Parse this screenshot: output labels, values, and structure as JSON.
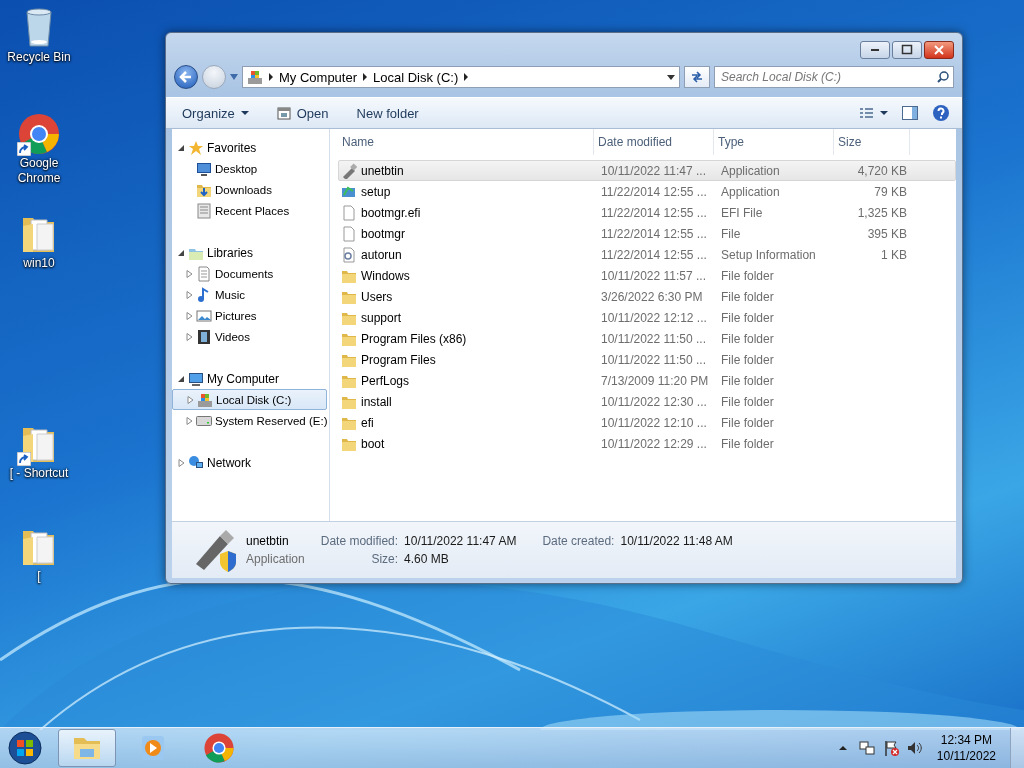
{
  "desktop": {
    "icons": [
      {
        "label": "Recycle Bin",
        "kind": "recycle",
        "shortcut": false
      },
      {
        "label": "Google Chrome",
        "kind": "chrome",
        "shortcut": true
      },
      {
        "label": "win10",
        "kind": "folder",
        "shortcut": false
      },
      {
        "label": "[ - Shortcut",
        "kind": "folder",
        "shortcut": true
      },
      {
        "label": "[",
        "kind": "folder",
        "shortcut": false
      }
    ]
  },
  "window": {
    "controls": [
      {
        "kind": "minimize",
        "hovered": false
      },
      {
        "kind": "maximize",
        "hovered": false
      },
      {
        "kind": "close",
        "hovered": true
      }
    ],
    "address": {
      "crumbs": [
        "My Computer",
        "Local Disk (C:)"
      ]
    },
    "search": {
      "placeholder": "Search Local Disk (C:)"
    },
    "toolbar": [
      {
        "label": "Organize",
        "kind": "menu"
      },
      {
        "label": "Open",
        "kind": "open"
      },
      {
        "label": "New folder",
        "kind": "plain"
      }
    ],
    "navigation": [
      {
        "label": "Favorites",
        "kind": "star",
        "expanded": true,
        "selected": false,
        "children": [
          {
            "label": "Desktop",
            "kind": "desktop",
            "selected": false
          },
          {
            "label": "Downloads",
            "kind": "downloads",
            "selected": false
          },
          {
            "label": "Recent Places",
            "kind": "recent",
            "selected": false
          }
        ]
      },
      {
        "label": "Libraries",
        "kind": "library",
        "expanded": true,
        "selected": false,
        "children": [
          {
            "label": "Documents",
            "kind": "documents",
            "expanded": false,
            "selected": false
          },
          {
            "label": "Music",
            "kind": "music",
            "expanded": false,
            "selected": false
          },
          {
            "label": "Pictures",
            "kind": "pictures",
            "expanded": false,
            "selected": false
          },
          {
            "label": "Videos",
            "kind": "videos",
            "expanded": false,
            "selected": false
          }
        ]
      },
      {
        "label": "My Computer",
        "kind": "computer",
        "expanded": true,
        "selected": false,
        "children": [
          {
            "label": "Local Disk (C:)",
            "kind": "disk",
            "expanded": false,
            "selected": true
          },
          {
            "label": "System Reserved (E:)",
            "kind": "drive",
            "expanded": false,
            "selected": false
          }
        ]
      },
      {
        "label": "Network",
        "kind": "network",
        "expanded": false,
        "selected": false
      }
    ],
    "table": {
      "columns": [
        "Name",
        "Date modified",
        "Type",
        "Size"
      ],
      "rows": [
        {
          "name": "unetbtin",
          "kind": "usb",
          "date": "10/11/2022 11:47 ...",
          "type": "Application",
          "size": "4,720 KB",
          "selected": true
        },
        {
          "name": "setup",
          "kind": "setup",
          "date": "11/22/2014 12:55 ...",
          "type": "Application",
          "size": "79 KB",
          "selected": false
        },
        {
          "name": "bootmgr.efi",
          "kind": "file",
          "date": "11/22/2014 12:55 ...",
          "type": "EFI File",
          "size": "1,325 KB",
          "selected": false
        },
        {
          "name": "bootmgr",
          "kind": "file",
          "date": "11/22/2014 12:55 ...",
          "type": "File",
          "size": "395 KB",
          "selected": false
        },
        {
          "name": "autorun",
          "kind": "settings",
          "date": "11/22/2014 12:55 ...",
          "type": "Setup Information",
          "size": "1 KB",
          "selected": false
        },
        {
          "name": "Windows",
          "kind": "folder",
          "date": "10/11/2022 11:57 ...",
          "type": "File folder",
          "selected": false
        },
        {
          "name": "Users",
          "kind": "folder",
          "date": "3/26/2022 6:30 PM",
          "type": "File folder",
          "selected": false
        },
        {
          "name": "support",
          "kind": "folder",
          "date": "10/11/2022 12:12 ...",
          "type": "File folder",
          "selected": false
        },
        {
          "name": "Program Files (x86)",
          "kind": "folder",
          "date": "10/11/2022 11:50 ...",
          "type": "File folder",
          "selected": false
        },
        {
          "name": "Program Files",
          "kind": "folder",
          "date": "10/11/2022 11:50 ...",
          "type": "File folder",
          "selected": false
        },
        {
          "name": "PerfLogs",
          "kind": "folder",
          "date": "7/13/2009 11:20 PM",
          "type": "File folder",
          "selected": false
        },
        {
          "name": "install",
          "kind": "folder",
          "date": "10/11/2022 12:30 ...",
          "type": "File folder",
          "selected": false
        },
        {
          "name": "efi",
          "kind": "folder",
          "date": "10/11/2022 12:10 ...",
          "type": "File folder",
          "selected": false
        },
        {
          "name": "boot",
          "kind": "folder",
          "date": "10/11/2022 12:29 ...",
          "type": "File folder",
          "selected": false
        }
      ]
    },
    "details": {
      "name": "unetbtin",
      "type": "Application",
      "fields": [
        {
          "label": "Date modified:",
          "value": "10/11/2022 11:47 AM"
        },
        {
          "label": "Date created:",
          "value": "10/11/2022 11:48 AM"
        },
        {
          "label": "Size:",
          "value": "4.60 MB"
        }
      ]
    }
  },
  "taskbar": {
    "items": [
      {
        "kind": "explorer",
        "active": true
      },
      {
        "kind": "media",
        "active": false
      },
      {
        "kind": "chrome",
        "active": false
      }
    ],
    "tray": {
      "time": "12:34 PM",
      "date": "10/11/2022"
    }
  }
}
